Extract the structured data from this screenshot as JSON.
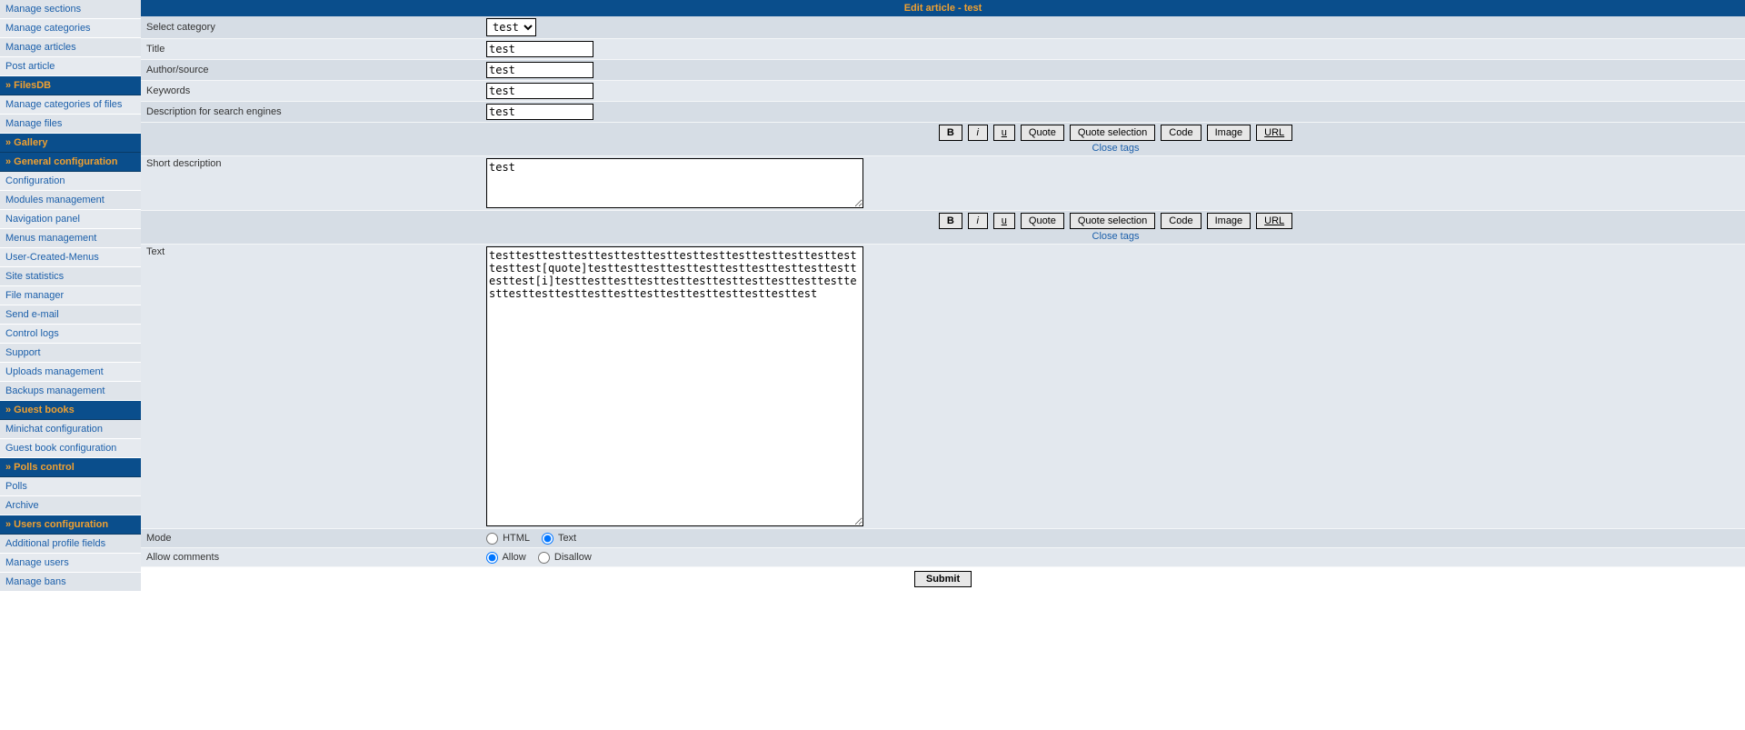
{
  "sidebar": [
    {
      "type": "item",
      "label": "Manage sections"
    },
    {
      "type": "item",
      "label": "Manage categories"
    },
    {
      "type": "item",
      "label": "Manage articles"
    },
    {
      "type": "item",
      "label": "Post article"
    },
    {
      "type": "header",
      "label": "» FilesDB"
    },
    {
      "type": "item",
      "label": "Manage categories of files"
    },
    {
      "type": "item",
      "label": "Manage files"
    },
    {
      "type": "header",
      "label": "» Gallery"
    },
    {
      "type": "header",
      "label": "» General configuration"
    },
    {
      "type": "item",
      "label": "Configuration"
    },
    {
      "type": "item",
      "label": "Modules management"
    },
    {
      "type": "item",
      "label": "Navigation panel"
    },
    {
      "type": "item",
      "label": "Menus management"
    },
    {
      "type": "item",
      "label": "User-Created-Menus"
    },
    {
      "type": "item",
      "label": "Site statistics"
    },
    {
      "type": "item",
      "label": "File manager"
    },
    {
      "type": "item",
      "label": "Send e-mail"
    },
    {
      "type": "item",
      "label": "Control logs"
    },
    {
      "type": "item",
      "label": "Support"
    },
    {
      "type": "item",
      "label": "Uploads management"
    },
    {
      "type": "item",
      "label": "Backups management"
    },
    {
      "type": "header",
      "label": "» Guest books"
    },
    {
      "type": "item",
      "label": "Minichat configuration"
    },
    {
      "type": "item",
      "label": "Guest book configuration"
    },
    {
      "type": "header",
      "label": "» Polls control"
    },
    {
      "type": "item",
      "label": "Polls"
    },
    {
      "type": "item",
      "label": "Archive"
    },
    {
      "type": "header",
      "label": "» Users configuration"
    },
    {
      "type": "item",
      "label": "Additional profile fields"
    },
    {
      "type": "item",
      "label": "Manage users"
    },
    {
      "type": "item",
      "label": "Manage bans"
    }
  ],
  "page_title": "Edit article - test",
  "form": {
    "category": {
      "label": "Select category",
      "value": "test"
    },
    "title": {
      "label": "Title",
      "value": "test"
    },
    "author": {
      "label": "Author/source",
      "value": "test"
    },
    "keywords": {
      "label": "Keywords",
      "value": "test"
    },
    "desc": {
      "label": "Description for search engines",
      "value": "test"
    },
    "short": {
      "label": "Short description",
      "value": "test"
    },
    "text": {
      "label": "Text",
      "value": "testtesttesttesttesttesttesttesttesttesttesttesttesttesttesttest[quote]testtesttesttesttesttesttesttesttesttesttesttest[i]testtesttesttesttesttesttesttesttesttesttesttesttesttesttesttesttesttesttesttesttesttesttesttest"
    },
    "mode": {
      "label": "Mode",
      "options": [
        "HTML",
        "Text"
      ],
      "selected": "Text"
    },
    "comments": {
      "label": "Allow comments",
      "options": [
        "Allow",
        "Disallow"
      ],
      "selected": "Allow"
    }
  },
  "toolbar": {
    "b": "B",
    "i": "i",
    "u": "u",
    "quote": "Quote",
    "quotesel": "Quote selection",
    "code": "Code",
    "image": "Image",
    "url": "URL",
    "close": "Close tags"
  },
  "submit": "Submit"
}
